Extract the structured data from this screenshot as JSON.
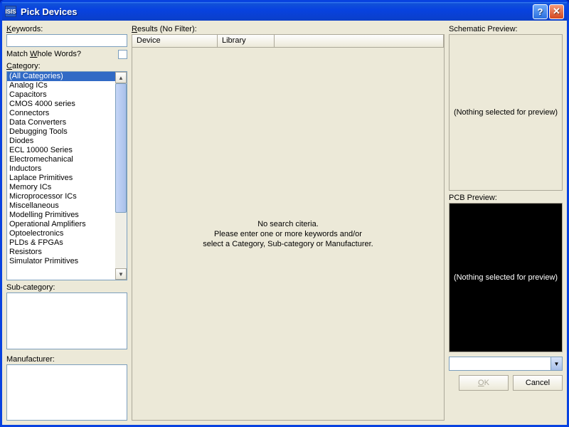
{
  "window": {
    "title": "Pick Devices",
    "icon_text": "ISIS"
  },
  "left": {
    "keywords_label": "Keywords:",
    "keywords_underline": "K",
    "keywords_value": "",
    "match_label": "Match Whole Words?",
    "match_underline": "W",
    "category_label": "Category:",
    "category_underline": "C",
    "categories": [
      "(All Categories)",
      "Analog ICs",
      "Capacitors",
      "CMOS 4000 series",
      "Connectors",
      "Data Converters",
      "Debugging Tools",
      "Diodes",
      "ECL 10000 Series",
      "Electromechanical",
      "Inductors",
      "Laplace Primitives",
      "Memory ICs",
      "Microprocessor ICs",
      "Miscellaneous",
      "Modelling Primitives",
      "Operational Amplifiers",
      "Optoelectronics",
      "PLDs & FPGAs",
      "Resistors",
      "Simulator Primitives"
    ],
    "selected_category_index": 0,
    "subcategory_label": "Sub-category:",
    "manufacturer_label": "Manufacturer:"
  },
  "results": {
    "label": "Results (No Filter):",
    "label_underline": "R",
    "columns": {
      "device": "Device",
      "library": "Library"
    },
    "empty_line1": "No search citeria.",
    "empty_line2": "Please enter one or more keywords and/or",
    "empty_line3": "select a Category, Sub-category or Manufacturer."
  },
  "preview": {
    "schematic_label": "Schematic Preview:",
    "schematic_placeholder": "(Nothing selected for preview)",
    "pcb_label": "PCB Preview:",
    "pcb_placeholder": "(Nothing selected for preview)",
    "dropdown_value": ""
  },
  "buttons": {
    "ok": "OK",
    "cancel": "Cancel"
  }
}
